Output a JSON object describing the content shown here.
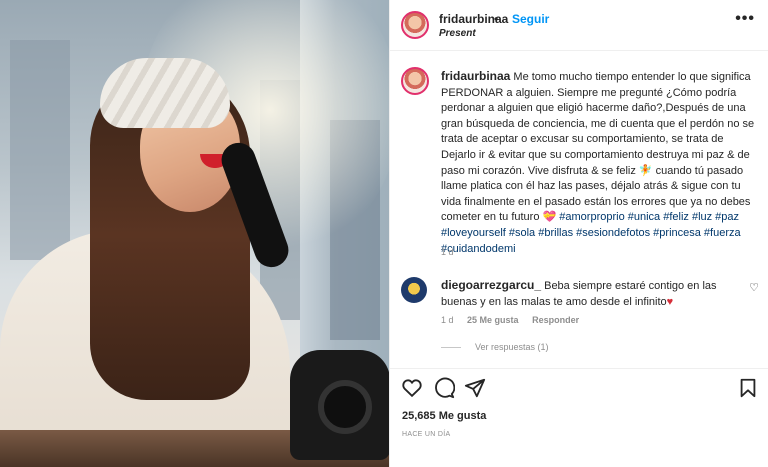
{
  "post": {
    "author": "fridaurbinaa",
    "separator": "•",
    "follow_label": "Seguir",
    "location": "Present",
    "more_label": "•••"
  },
  "caption": {
    "author": "fridaurbinaa",
    "body": " Me tomo mucho tiempo entender lo que significa PERDONAR a alguien. Siempre me pregunté ¿Cómo podría perdonar a alguien que eligió hacerme daño?,Después de una gran búsqueda de conciencia, me di cuenta que el perdón no se trata de aceptar o excusar su comportamiento, se trata de Dejarlo ir & evitar que su comportamiento destruya mi paz & de paso mi corazón. Vive disfruta & se feliz 🧚 cuando tú pasado llame platica con él haz las pases, déjalo atrás & sigue con tu vida finalmente en el pasado están los errores que ya no debes cometer en tu futuro 💝",
    "hashtags": "#amorproprio #unica #feliz #luz #paz #loveyourself #sola #brillas #sesiondefotos #princesa #fuerza #cuidandodemi",
    "timestamp": "1 d"
  },
  "comment": {
    "author": "diegoarrezgarcu_",
    "body": " Beba siempre estaré contigo en las buenas y en las malas te amo desde el infinito",
    "emoji": "♥",
    "like_icon": "heart-outline-icon",
    "like_glyph": "♡",
    "time": "1 d",
    "likes": "25 Me gusta",
    "reply_label": "Responder"
  },
  "replies_label": "Ver respuestas (1)",
  "actions": {
    "likes_count": "25,685 Me gusta",
    "posted": "HACE UN DÍA",
    "icons": [
      "heart-outline-icon",
      "comment-icon",
      "share-icon",
      "bookmark-icon"
    ]
  },
  "colors": {
    "accent": "#0095f6",
    "hashtag": "#00376b",
    "muted": "#8e8e8e",
    "heart": "#d62f3a"
  }
}
